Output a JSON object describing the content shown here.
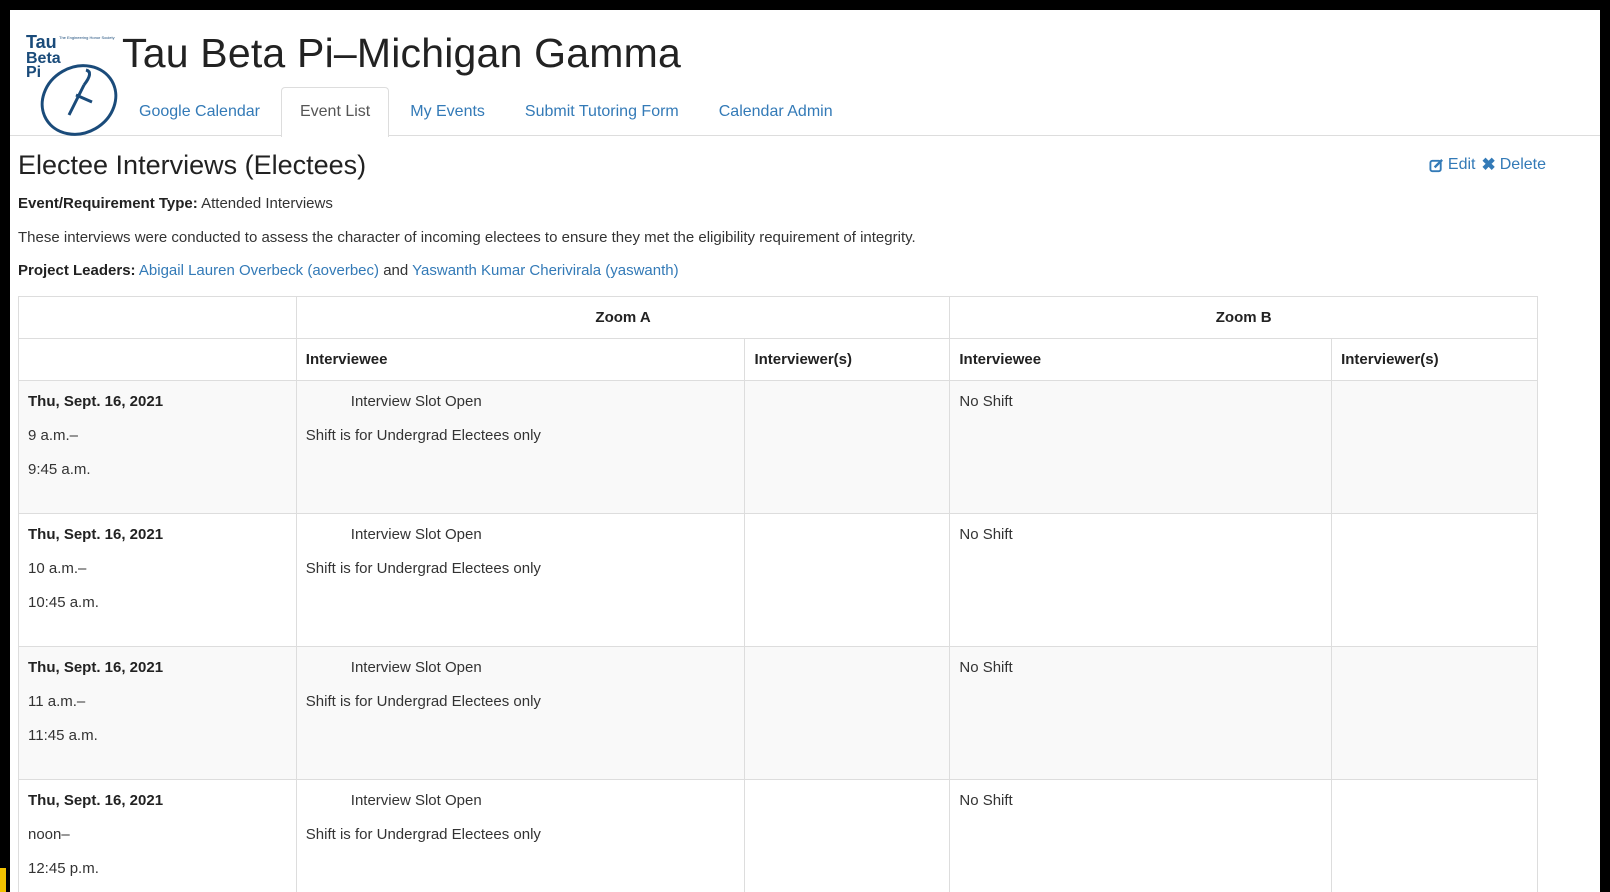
{
  "site": {
    "logo_text": [
      "Tau",
      "Beta",
      "Pi",
      "The Engineering Honor Society"
    ],
    "title": "Tau Beta Pi–Michigan Gamma"
  },
  "tabs": [
    {
      "label": "Google Calendar",
      "active": false
    },
    {
      "label": "Event List",
      "active": true
    },
    {
      "label": "My Events",
      "active": false
    },
    {
      "label": "Submit Tutoring Form",
      "active": false
    },
    {
      "label": "Calendar Admin",
      "active": false
    }
  ],
  "event": {
    "title": "Electee Interviews (Electees)",
    "edit_label": "Edit",
    "delete_label": "Delete",
    "type_label": "Event/Requirement Type:",
    "type_value": "Attended Interviews",
    "description": "These interviews were conducted to assess the character of incoming electees to ensure they met the eligibility requirement of integrity.",
    "leaders_label": "Project Leaders:",
    "leader_1": "Abigail Lauren Overbeck (aoverbec)",
    "leaders_and": "and",
    "leader_2": "Yaswanth Kumar Cherivirala (yaswanth)"
  },
  "table": {
    "group_a": "Zoom A",
    "group_b": "Zoom B",
    "columns": [
      "Interviewee",
      "Interviewer(s)",
      "Interviewee",
      "Interviewer(s)"
    ],
    "rows": [
      {
        "date": "Thu, Sept. 16, 2021",
        "start": "9 a.m.–",
        "end": "9:45 a.m.",
        "a_status": "Interview Slot Open",
        "a_note": "Shift is for Undergrad Electees only",
        "b_status": "No Shift"
      },
      {
        "date": "Thu, Sept. 16, 2021",
        "start": "10 a.m.–",
        "end": "10:45 a.m.",
        "a_status": "Interview Slot Open",
        "a_note": "Shift is for Undergrad Electees only",
        "b_status": "No Shift"
      },
      {
        "date": "Thu, Sept. 16, 2021",
        "start": "11 a.m.–",
        "end": "11:45 a.m.",
        "a_status": "Interview Slot Open",
        "a_note": "Shift is for Undergrad Electees only",
        "b_status": "No Shift"
      },
      {
        "date": "Thu, Sept. 16, 2021",
        "start": "noon–",
        "end": "12:45 p.m.",
        "a_status": "Interview Slot Open",
        "a_note": "Shift is for Undergrad Electees only",
        "b_status": "No Shift"
      }
    ]
  },
  "colors": {
    "link": "#337ab7",
    "border": "#dddddd",
    "stripe": "#f9f9f9",
    "accent": "#f2c200"
  }
}
